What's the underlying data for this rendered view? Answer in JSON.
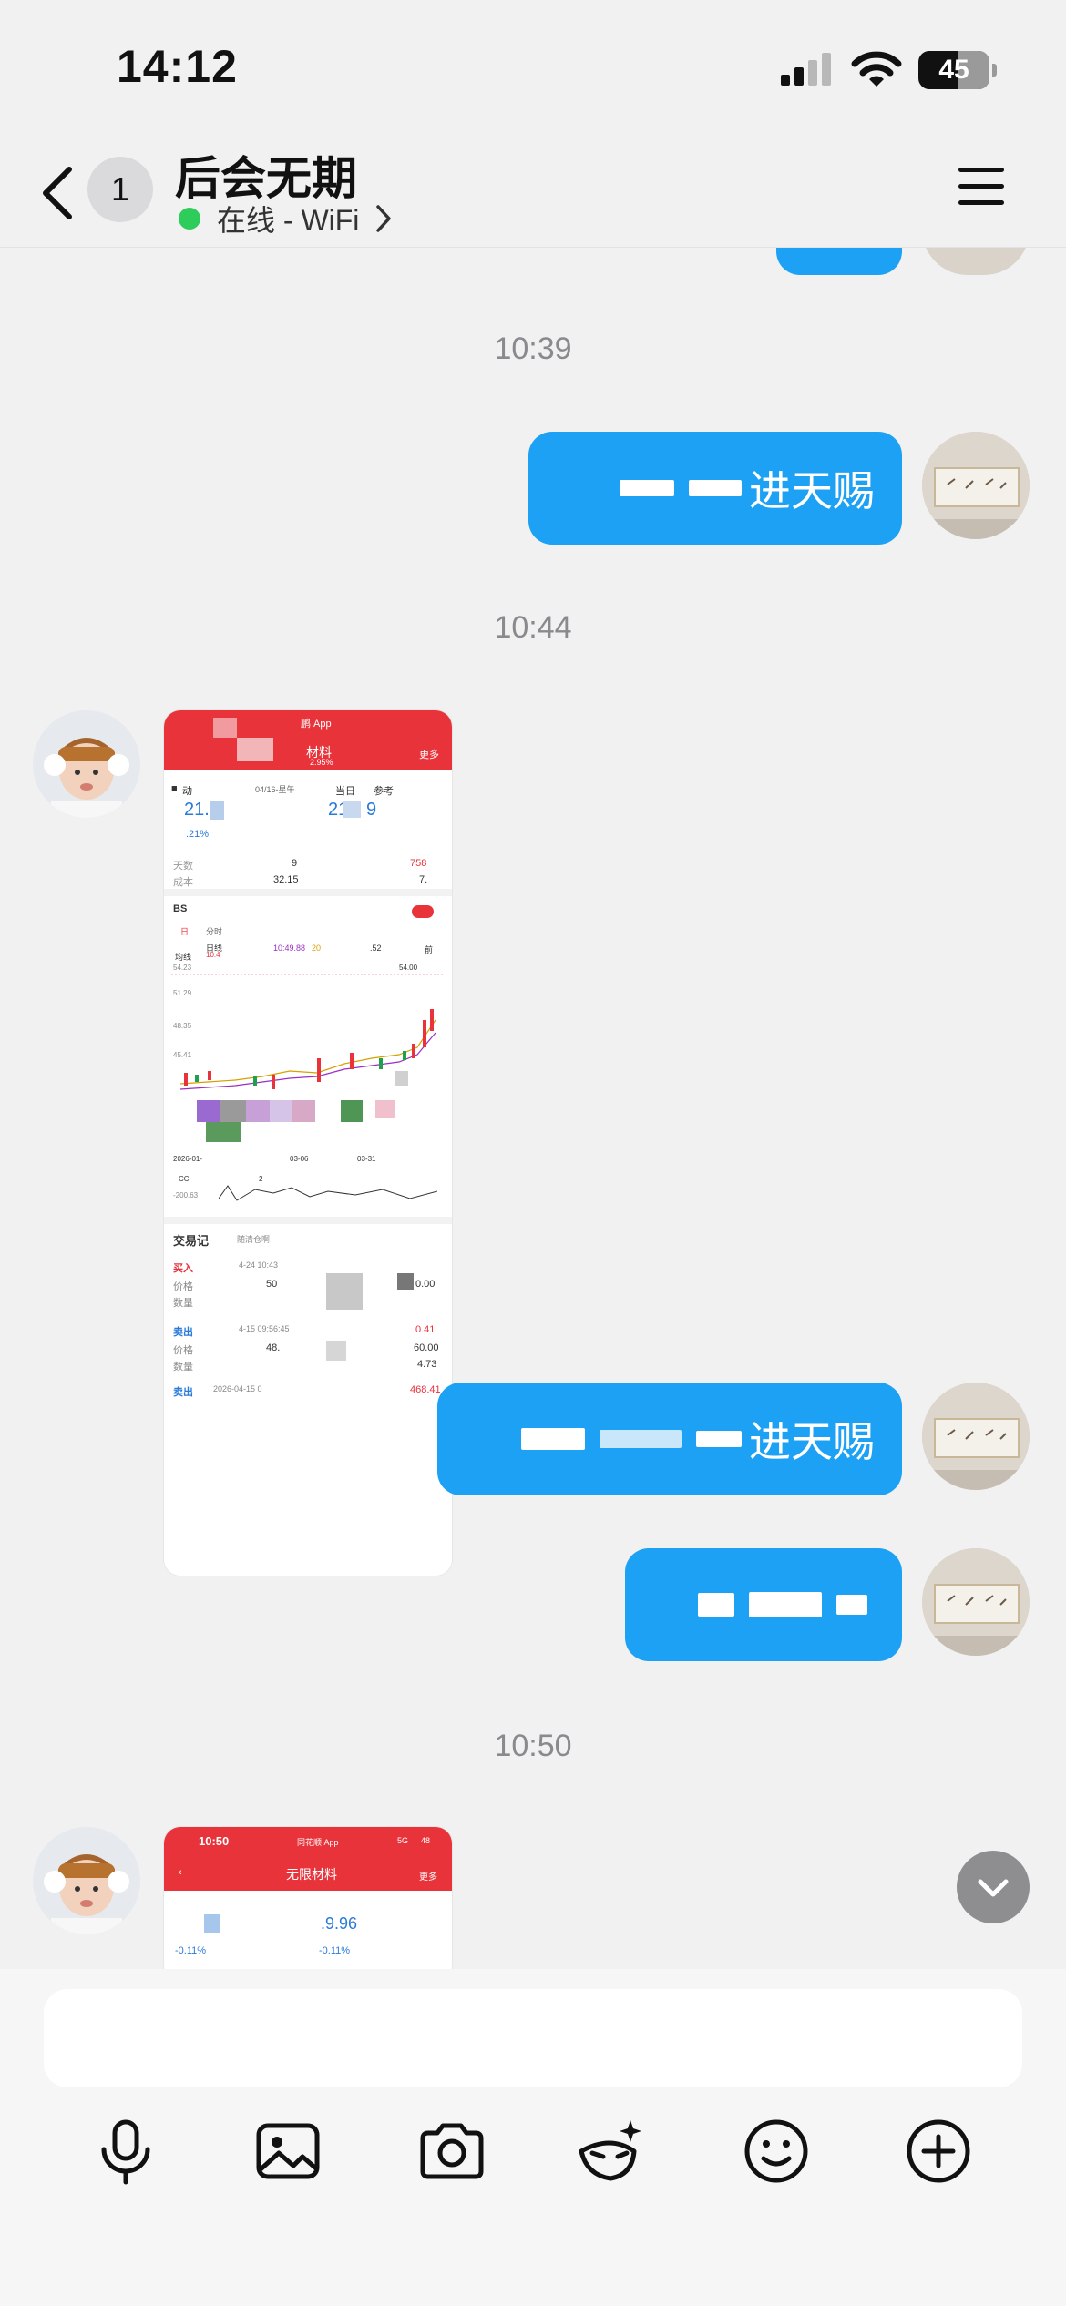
{
  "status_bar": {
    "time": "14:12",
    "battery": "45"
  },
  "header": {
    "unread_count": "1",
    "contact_name": "后会无期",
    "presence": "在线 - WiFi"
  },
  "chat": {
    "time_1": "10:39",
    "msg_1_text": "进天赐",
    "time_2": "10:44",
    "msg_2_text": "进天赐",
    "msg_3_text": "",
    "time_3": "10:50"
  },
  "shot_1": {
    "app_label": "鹏 App",
    "title": "材料",
    "back": "◀",
    "more": "更多",
    "header_pct": "2.95%",
    "date": "04/16-星午",
    "ref": "参考",
    "price_a": "21.",
    "price_b": "21",
    "price_b2": "9",
    "pct_a": ".21%",
    "row1_a": "天数",
    "row1_b": "9",
    "row1_c": "758",
    "row2_a": "成本",
    "row2_b": "32.15",
    "row2_c": "7.",
    "kline_title": "BS",
    "tab_day": "日线",
    "ma": "均线",
    "ma_val": "10.4",
    "k_time": "10:49.88",
    "k_20": "20",
    "k_52": ".52",
    "k_right": "前",
    "y1": "54.23",
    "y2": "51.29",
    "y3": "48.35",
    "y4": "45.41",
    "hi_label": "54.00",
    "x1": "2026-01-",
    "x2": "03-06",
    "x3": "03-31",
    "cci": "CCI",
    "cci_val": "2",
    "cci_low": "-200.63",
    "trade_title": "交易记",
    "trade_hint": "随清仓啊",
    "buy": "买入",
    "buy_date": "4-24 10:43",
    "price_lbl": "价格",
    "qty_lbl": "数量",
    "buy_price": "50",
    "buy_right": "0.00",
    "sell": "卖出",
    "sell_date": "4-15 09:56:45",
    "sell_right": "0.41",
    "sell_price": "48.",
    "sell_right2": "60.00",
    "sell_right3": "4.73",
    "sell2": "卖出",
    "sell2_date": "2026-04-15 0",
    "sell2_right": "468.41"
  },
  "shot_2": {
    "time": "10:50",
    "app_label": "同花顺 App",
    "net": "5G",
    "batt": "48",
    "title": "无限材料",
    "more": "更多",
    "price": ".9.96",
    "pct_a": "-0.11%",
    "pct_b": "-0.11%"
  },
  "toolbar": {
    "icons": [
      "microphone-icon",
      "image-icon",
      "camera-icon",
      "sticker-icon",
      "emoji-icon",
      "plus-icon"
    ]
  },
  "colors": {
    "bubble": "#1da1f5",
    "red_header": "#e8333b",
    "online": "#2ecc5a"
  }
}
